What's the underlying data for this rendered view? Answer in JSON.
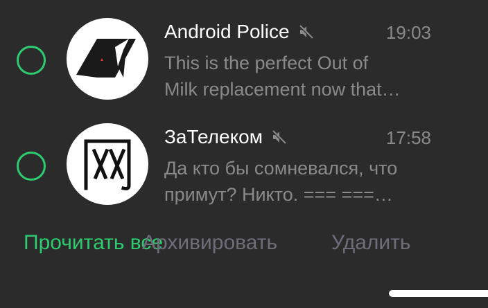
{
  "chats": [
    {
      "name": "Android Police",
      "time": "19:03",
      "muted": true,
      "preview_line1": "This is the perfect Out of",
      "preview_line2": "Milk replacement now that…",
      "avatar_icon": "android-police-logo"
    },
    {
      "name": "ЗаТелеком",
      "time": "17:58",
      "muted": true,
      "preview_line1": "Да кто бы сомневался, что",
      "preview_line2": "примут? Никто. === ===…",
      "avatar_icon": "wang-character-logo"
    }
  ],
  "actions": {
    "read": "Прочитать все",
    "archive": "Архивировать",
    "delete": "Удалить"
  },
  "colors": {
    "background": "#2b2b2b",
    "accent": "#2ecc71",
    "secondary_text": "#8a8a8a",
    "disabled_action": "#6e6e7a"
  }
}
